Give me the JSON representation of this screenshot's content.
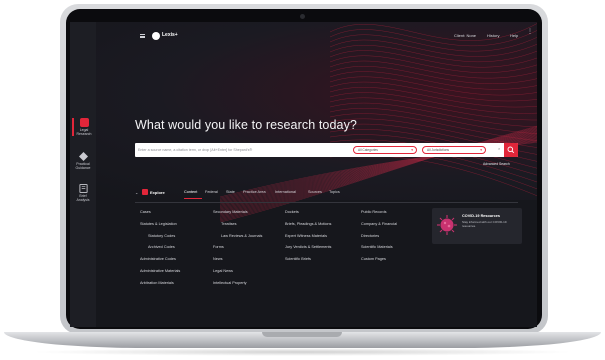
{
  "header": {
    "logo_text": "Lexis+",
    "nav": [
      "Client: None",
      "History",
      "Help"
    ]
  },
  "rail": {
    "items": [
      {
        "label_line1": "Legal",
        "label_line2": "Research",
        "active": true
      },
      {
        "label_line1": "Practical",
        "label_line2": "Guidance",
        "active": false
      },
      {
        "label_line1": "Brief",
        "label_line2": "Analysis",
        "active": false
      }
    ]
  },
  "hero": {
    "headline": "What would you like to research today?",
    "search_placeholder": "Enter a source name, a citation term, or drop [Alt+Enter] for Shepard's®",
    "category_select": "All Categories",
    "jurisdiction_select": "All Jurisdictions",
    "advanced_search": "Advanced Search"
  },
  "explore": {
    "label": "Explore",
    "tabs": [
      "Content",
      "Federal",
      "State",
      "Practice Area",
      "International",
      "Sources",
      "Topics"
    ]
  },
  "columns": [
    {
      "items": [
        {
          "t": "Cases"
        },
        {
          "t": "Statutes & Legislation"
        },
        {
          "t": "Statutory Codes",
          "indent": true
        },
        {
          "t": "Archived Codes",
          "indent": true
        },
        {
          "t": "Administrative Codes"
        },
        {
          "t": "Administrative Materials"
        },
        {
          "t": "Arbitration Materials"
        }
      ]
    },
    {
      "items": [
        {
          "t": "Secondary Materials"
        },
        {
          "t": "Treatises",
          "indent": true
        },
        {
          "t": "Law Reviews & Journals",
          "indent": true
        },
        {
          "t": "Forms"
        },
        {
          "t": "News"
        },
        {
          "t": "Legal News"
        },
        {
          "t": "Intellectual Property"
        }
      ]
    },
    {
      "items": [
        {
          "t": "Dockets"
        },
        {
          "t": "Briefs, Pleadings & Motions"
        },
        {
          "t": "Expert Witness Materials"
        },
        {
          "t": "Jury Verdicts & Settlements"
        },
        {
          "t": "Scientific Briefs"
        }
      ]
    },
    {
      "items": [
        {
          "t": "Public Records"
        },
        {
          "t": "Company & Financial"
        },
        {
          "t": "Directories"
        },
        {
          "t": "Scientific Materials"
        },
        {
          "t": "Custom Pages"
        }
      ]
    }
  ],
  "covid_card": {
    "title": "COVID-19 Resources",
    "description": "Stay informed with our COVID-19 resources."
  },
  "colors": {
    "accent": "#e2263a",
    "background": "#16171c"
  }
}
